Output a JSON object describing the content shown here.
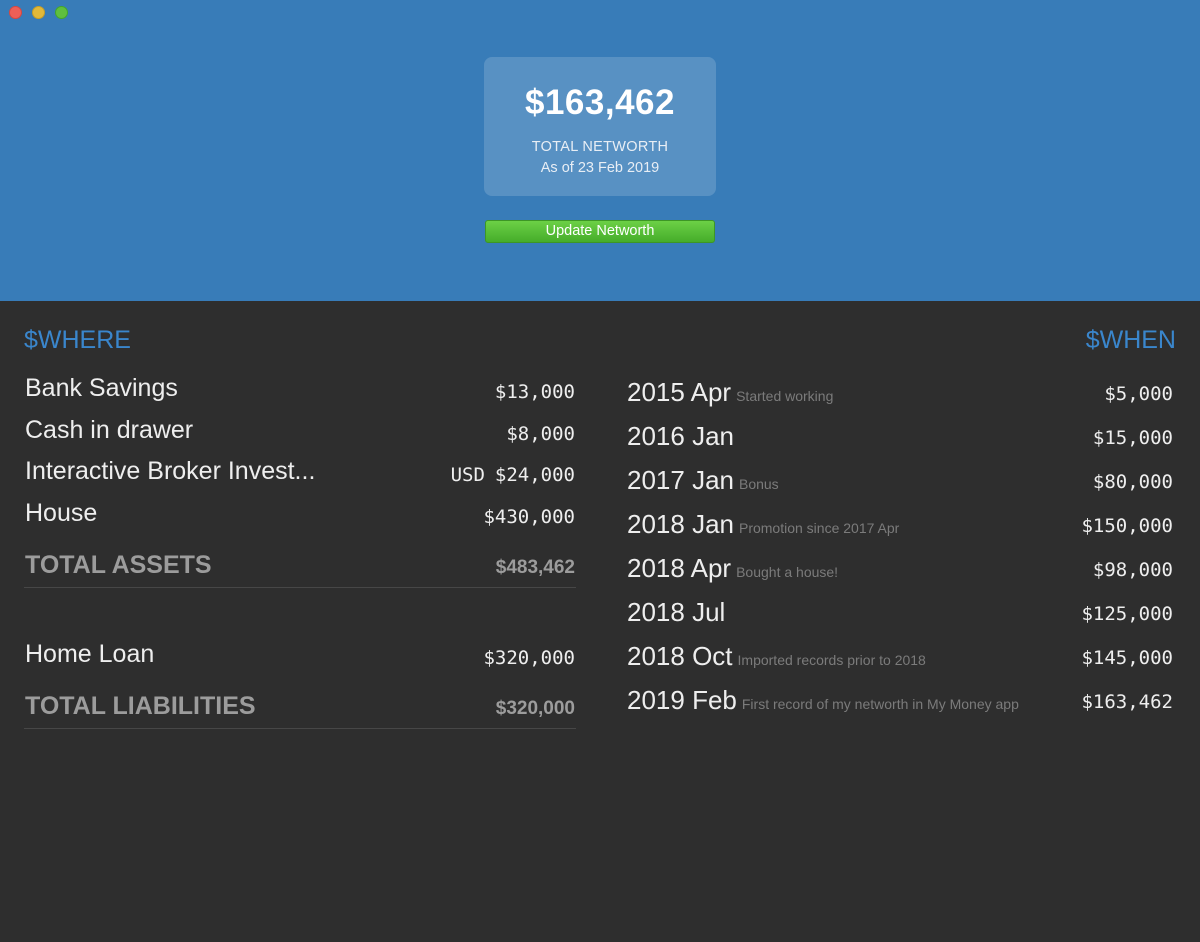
{
  "window": {
    "controls": [
      "close",
      "minimize",
      "maximize"
    ]
  },
  "summary": {
    "amount": "$163,462",
    "label": "TOTAL NETWORTH",
    "date": "As of 23 Feb 2019",
    "update_button": "Update Networth"
  },
  "where": {
    "title": "$WHERE",
    "assets": [
      {
        "name": "Bank Savings",
        "currency": "",
        "value": "$13,000"
      },
      {
        "name": "Cash in drawer",
        "currency": "",
        "value": "$8,000"
      },
      {
        "name": "Interactive Broker Invest...",
        "currency": "USD",
        "value": "$24,000"
      },
      {
        "name": "House",
        "currency": "",
        "value": "$430,000"
      }
    ],
    "total_assets_label": "TOTAL ASSETS",
    "total_assets_value": "$483,462",
    "liabilities": [
      {
        "name": "Home Loan",
        "currency": "",
        "value": "$320,000"
      }
    ],
    "total_liabilities_label": "TOTAL LIABILITIES",
    "total_liabilities_value": "$320,000"
  },
  "when": {
    "title": "$WHEN",
    "records": [
      {
        "date": "2015 Apr",
        "note": "Started working",
        "value": "$5,000"
      },
      {
        "date": "2016 Jan",
        "note": "",
        "value": "$15,000"
      },
      {
        "date": "2017 Jan",
        "note": "Bonus",
        "value": "$80,000"
      },
      {
        "date": "2018 Jan",
        "note": "Promotion since 2017 Apr",
        "value": "$150,000"
      },
      {
        "date": "2018 Apr",
        "note": "Bought a house!",
        "value": "$98,000"
      },
      {
        "date": "2018 Jul",
        "note": "",
        "value": "$125,000"
      },
      {
        "date": "2018 Oct",
        "note": "Imported records prior to 2018",
        "value": "$145,000"
      },
      {
        "date": "2019 Feb",
        "note": "First record of my networth in My Money app",
        "value": "$163,462"
      }
    ]
  },
  "colors": {
    "header_bg": "#387cb8",
    "body_bg": "#2e2e2e",
    "accent_blue": "#3a86cc",
    "button_green": "#5bc23a"
  }
}
